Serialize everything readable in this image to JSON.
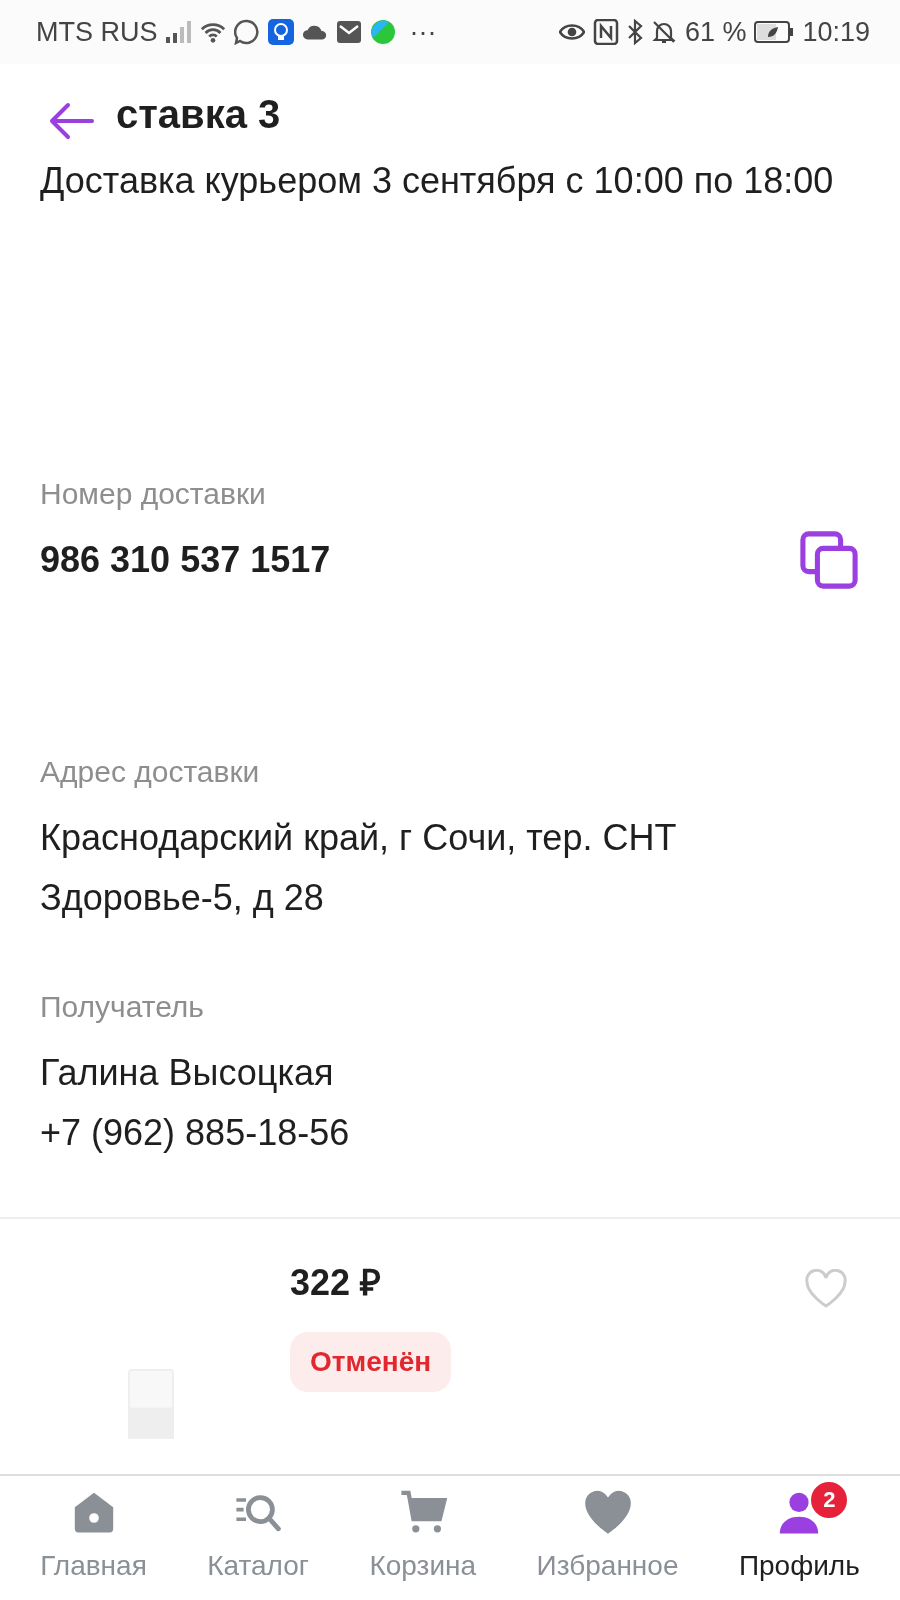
{
  "status_bar": {
    "carrier": "MTS RUS",
    "battery": "61 %",
    "time": "10:19",
    "more": "···"
  },
  "header": {
    "title": "ставка 3",
    "subtitle": "Доставка курьером 3 сентября с 10:00 по 18:00"
  },
  "fields": [
    {
      "kind": "code",
      "label": "Номер доставки",
      "lines": [
        "986 310 537 1517"
      ]
    },
    {
      "kind": "text",
      "label": "Адрес доставки",
      "lines": [
        "Краснодарский край, г Сочи, тер. СНТ Здоровье-5, д 28"
      ]
    },
    {
      "kind": "text",
      "label": "Получатель",
      "lines": [
        "Галина Высоцкая",
        "+7 (962) 885-18-56"
      ]
    }
  ],
  "item": {
    "kind": "picture",
    "price": "322 ₽",
    "status": "Отменён",
    "favorite": false
  },
  "nav": [
    {
      "kind": "home",
      "label": "Главная",
      "selected": false
    },
    {
      "kind": "catalog",
      "label": "Каталог",
      "selected": false
    },
    {
      "kind": "cart",
      "label": "Корзина",
      "selected": false
    },
    {
      "kind": "favorites",
      "label": "Избранное",
      "selected": false
    },
    {
      "kind": "profile",
      "label": "Профиль",
      "selected": true,
      "badge": "2"
    }
  ]
}
